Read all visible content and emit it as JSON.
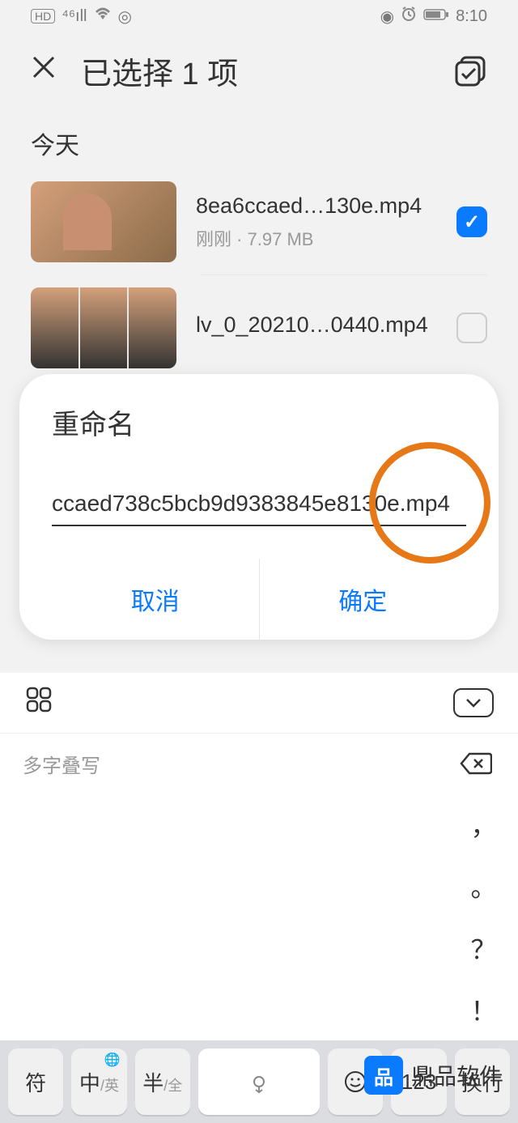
{
  "status": {
    "time": "8:10",
    "hd": "HD",
    "signal": "⁴⁶ıll",
    "wifi_icon": "wifi",
    "ring": "◎",
    "eye": "◉",
    "alarm": "⏰",
    "battery": "▬"
  },
  "header": {
    "title": "已选择 1 项"
  },
  "section": {
    "today": "今天"
  },
  "files": [
    {
      "name": "8ea6ccaed…130e.mp4",
      "meta": "刚刚 · 7.97 MB",
      "checked": true
    },
    {
      "name": "lv_0_20210…0440.mp4",
      "meta": "",
      "checked": false
    }
  ],
  "dialog": {
    "title": "重命名",
    "value": "ccaed738c5bcb9d9383845e8130e.mp4",
    "cancel": "取消",
    "confirm": "确定"
  },
  "keyboard": {
    "hint": "多字叠写",
    "side": [
      "，",
      "。",
      "？",
      "！"
    ],
    "keys": {
      "sym": "符",
      "cn": "中",
      "cn_sub": "/英",
      "half": "半",
      "half_sub": "/全",
      "emoji": "☺",
      "num": "123",
      "enter": "换行",
      "globe": "🌐"
    }
  },
  "watermark": {
    "logo": "品",
    "text": "鼎品软件"
  }
}
